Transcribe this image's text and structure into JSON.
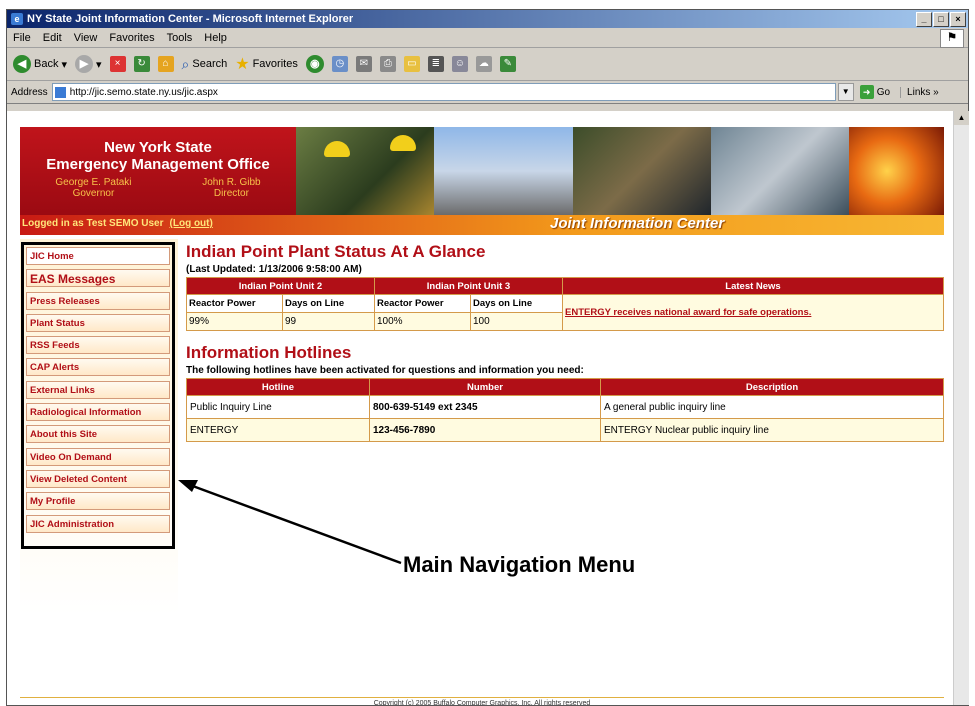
{
  "window": {
    "title": "NY State Joint Information Center - Microsoft Internet Explorer"
  },
  "menu": [
    "File",
    "Edit",
    "View",
    "Favorites",
    "Tools",
    "Help"
  ],
  "toolbar": {
    "back": "Back",
    "search": "Search",
    "favorites": "Favorites"
  },
  "address": {
    "label": "Address",
    "url": "http://jic.semo.state.ny.us/jic.aspx",
    "go": "Go",
    "links": "Links"
  },
  "banner": {
    "org_line1": "New York State",
    "org_line2": "Emergency Management Office",
    "official1_name": "George E. Pataki",
    "official1_title": "Governor",
    "official2_name": "John R. Gibb",
    "official2_title": "Director",
    "login_text": "Logged in as Test SEMO User",
    "logout": "(Log out)",
    "center_name": "Joint Information Center"
  },
  "nav": {
    "items": [
      {
        "label": "JIC Home"
      },
      {
        "label": "EAS Messages"
      },
      {
        "label": "Press Releases"
      },
      {
        "label": "Plant Status"
      },
      {
        "label": "RSS Feeds"
      },
      {
        "label": "CAP Alerts"
      },
      {
        "label": "External Links"
      },
      {
        "label": "Radiological Information"
      },
      {
        "label": "About this Site"
      },
      {
        "label": "Video On Demand"
      },
      {
        "label": "View Deleted Content"
      },
      {
        "label": "My Profile"
      },
      {
        "label": "JIC Administration"
      }
    ]
  },
  "status": {
    "title": "Indian Point Plant Status At A Glance",
    "updated": "(Last Updated: 1/13/2006 9:58:00 AM)",
    "unit2": "Indian Point Unit 2",
    "unit3": "Indian Point Unit 3",
    "news_header": "Latest News",
    "col_power": "Reactor Power",
    "col_days": "Days on Line",
    "u2_power": "99%",
    "u2_days": "99",
    "u3_power": "100%",
    "u3_days": "100",
    "news": "ENTERGY receives national award for safe operations."
  },
  "hotlines": {
    "title": "Information Hotlines",
    "intro": "The following hotlines have been activated for questions and information you need:",
    "headers": [
      "Hotline",
      "Number",
      "Description"
    ],
    "rows": [
      {
        "hotline": "Public Inquiry Line",
        "number": "800-639-5149 ext 2345",
        "description": "A general public inquiry line"
      },
      {
        "hotline": "ENTERGY",
        "number": "123-456-7890",
        "description": "ENTERGY Nuclear public inquiry line"
      }
    ]
  },
  "footer": "Copyright (c) 2005 Buffalo Computer Graphics, Inc. All rights reserved",
  "annotation": "Main Navigation Menu"
}
